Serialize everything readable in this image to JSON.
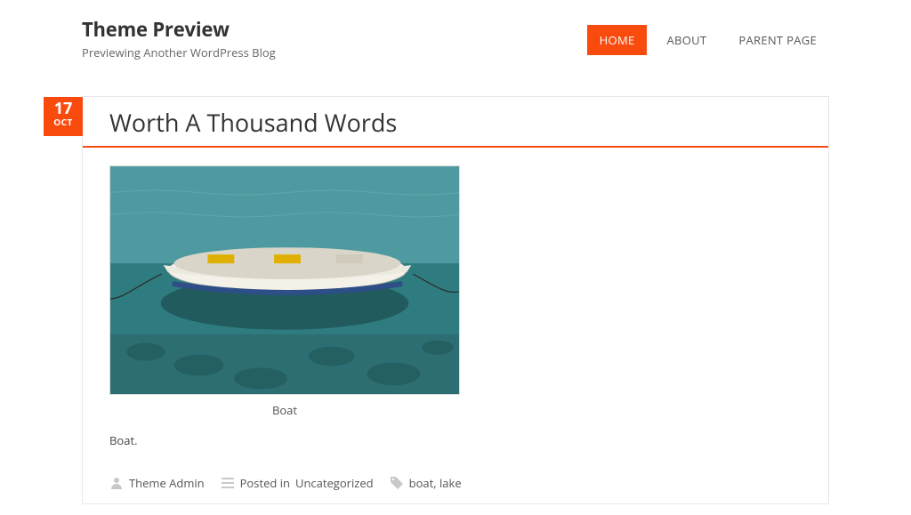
{
  "site": {
    "title": "Theme Preview",
    "tagline": "Previewing Another WordPress Blog"
  },
  "nav": {
    "items": [
      {
        "label": "HOME",
        "active": true
      },
      {
        "label": "ABOUT",
        "active": false
      },
      {
        "label": "PARENT PAGE",
        "active": false
      }
    ]
  },
  "post": {
    "date": {
      "day": "17",
      "month": "OCT"
    },
    "title": "Worth A Thousand Words",
    "image_caption": "Boat",
    "excerpt": "Boat.",
    "meta": {
      "author": "Theme Admin",
      "category_prefix": "Posted in ",
      "category": "Uncategorized",
      "tags": "boat, lake"
    }
  }
}
